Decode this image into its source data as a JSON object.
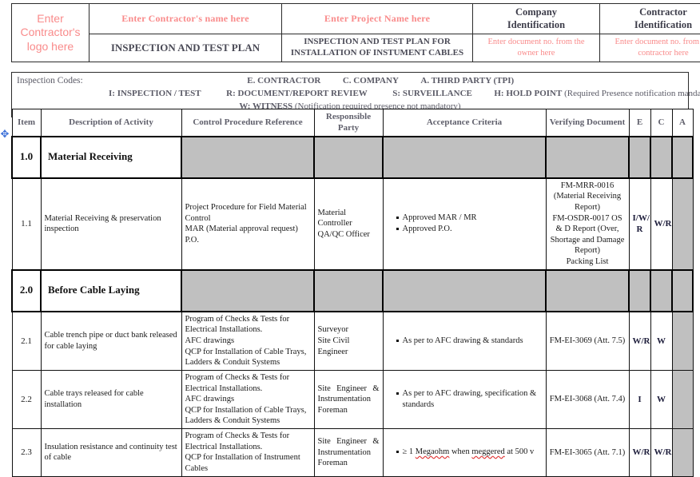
{
  "header": {
    "logo_placeholder": "Enter Contractor's logo here",
    "contractor_name_placeholder": "Enter Contractor's name here",
    "project_name_placeholder": "Enter Project Name here",
    "company_identification": "Company\nIdentification",
    "company_identification_l1": "Company",
    "company_identification_l2": "Identification",
    "contractor_identification_l1": "Contractor",
    "contractor_identification_l2": "Identification",
    "doc_title": "INSPECTION AND TEST PLAN",
    "doc_subtitle_l1": "INSPECTION AND TEST PLAN FOR",
    "doc_subtitle_l2": "INSTALLATION OF INSTUMENT CABLES",
    "company_doc_placeholder_l1": "Enter document no. from the",
    "company_doc_placeholder_l2": "owner here",
    "contractor_doc_placeholder_l1": "Enter document no. from the",
    "contractor_doc_placeholder_l2": "contractor here"
  },
  "inspection_codes": {
    "label": "Inspection Codes:",
    "line1_items": [
      "E. CONTRACTOR",
      "C. COMPANY",
      "A. THIRD PARTY (TPI)"
    ],
    "line2_items": [
      "I: INSPECTION / TEST",
      "R: DOCUMENT/REPORT REVIEW",
      "S: SURVEILLANCE"
    ],
    "line2_hold_bold": "H: HOLD POINT",
    "line2_hold_rest": "(Required Presence notification mandatory)",
    "line3_bold": "W: WITNESS",
    "line3_rest": "(Notification required presence not mandatory)"
  },
  "table": {
    "columns": [
      "Item",
      "Description of Activity",
      "Control Procedure Reference",
      "Responsible Party",
      "Acceptance Criteria",
      "Verifying Document",
      "E",
      "C",
      "A"
    ],
    "rows": [
      {
        "kind": "section",
        "item": "1.0",
        "title": "Material Receiving"
      },
      {
        "kind": "data",
        "item": "1.1",
        "description": "Material Receiving & preservation inspection",
        "control_procedure": "Project Procedure for Field Material Control\nMAR (Material approval request)\nP.O.",
        "responsible_party": "Material Controller\nQA/QC Officer",
        "acceptance_criteria": [
          "Approved MAR / MR",
          "Approved P.O."
        ],
        "verifying_document": "FM-MRR-0016 (Material Receiving Report)\nFM-OSDR-0017 OS & D Report (Over, Shortage and Damage Report)\nPacking List",
        "e": "I/W/ R",
        "c": "W/R",
        "a": ""
      },
      {
        "kind": "section",
        "item": "2.0",
        "title": "Before Cable Laying"
      },
      {
        "kind": "data",
        "item": "2.1",
        "description": "Cable trench pipe or duct bank released for cable laying",
        "control_procedure": "Program of Checks & Tests for Electrical Installations.\nAFC drawings\nQCP for Installation of Cable Trays, Ladders & Conduit Systems",
        "responsible_party": "Surveyor\nSite Civil Engineer",
        "acceptance_criteria": [
          "As per to AFC drawing & standards"
        ],
        "verifying_document": "FM-EI-3069 (Att. 7.5)",
        "e": "W/R",
        "c": "W",
        "a": ""
      },
      {
        "kind": "data",
        "item": "2.2",
        "description": "Cable trays released for cable installation",
        "control_procedure": "Program of Checks & Tests for Electrical Installations.\nAFC drawings\nQCP for Installation of Cable Trays, Ladders & Conduit Systems",
        "responsible_party": "Site Engineer & Instrumentation Foreman",
        "acceptance_criteria": [
          "As per to AFC drawing, specification & standards"
        ],
        "verifying_document": "FM-EI-3068 (Att. 7.4)",
        "e": "I",
        "c": "W",
        "a": ""
      },
      {
        "kind": "data",
        "item": "2.3",
        "description": "Insulation resistance and continuity test of cable",
        "control_procedure": "Program of Checks & Tests for Electrical Installations.\nQCP for Installation of Instrument Cables",
        "responsible_party": "Site Engineer & Instrumentation Foreman",
        "acceptance_criteria": [
          "≥ 1 Megaohm when meggered at 500 v"
        ],
        "verifying_document": "FM-EI-3065 (Att. 7.1)",
        "e": "W/R",
        "c": "W/R",
        "a": ""
      }
    ]
  },
  "colors": {
    "placeholder_red": "#f98b8b",
    "header_gray_text": "#4a4a56",
    "section_gray": "#c0c0c0",
    "handle_blue": "#3a6fd8"
  },
  "icons": {
    "move_handle": "move-handle-icon"
  }
}
